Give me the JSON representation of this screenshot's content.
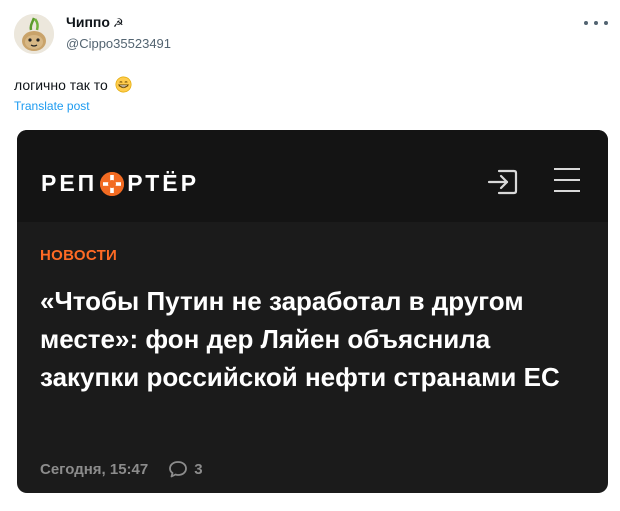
{
  "post": {
    "author": {
      "display_name": "Чиппо",
      "name_emoji": "☭",
      "handle": "@Cippo35523491"
    },
    "text": "логично так то",
    "text_emoji": "grinning-face",
    "translate_label": "Translate post"
  },
  "card": {
    "logo": {
      "left": "РЕП",
      "right": "РТЁР"
    },
    "section": "НОВОСТИ",
    "headline": "«Чтобы Путин не заработал в другом месте»: фон дер Ляйен объяснила закупки российской нефти странами ЕС",
    "date": "Сегодня, 15:47",
    "comments": "3"
  },
  "colors": {
    "accent": "#ff6a24",
    "link": "#1d9bf0",
    "card_bg": "#1b1b1b"
  },
  "icons": {
    "more": "more-dots-icon",
    "login": "login-icon",
    "menu": "hamburger-menu-icon",
    "comment": "comment-bubble-icon"
  }
}
